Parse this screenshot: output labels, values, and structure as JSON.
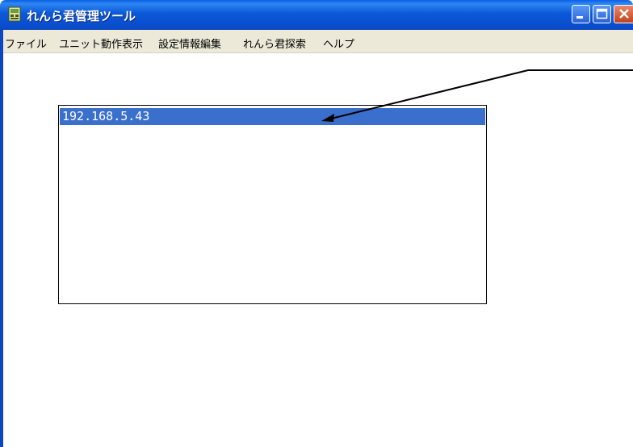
{
  "window": {
    "title": "れんら君管理ツール"
  },
  "menu": {
    "items": [
      "ファイル",
      "ユニット動作表示",
      "設定情報編集",
      "れんら君探索",
      "ヘルプ"
    ]
  },
  "list": {
    "items": [
      "192.168.5.43"
    ],
    "selected_index": 0
  },
  "colors": {
    "titlebar": "#0a4fd0",
    "selection": "#3a6fcc",
    "menubar": "#ece9d8"
  },
  "icons": [
    "app-icon",
    "minimize-icon",
    "maximize-icon",
    "close-icon",
    "arrow-annotation"
  ]
}
